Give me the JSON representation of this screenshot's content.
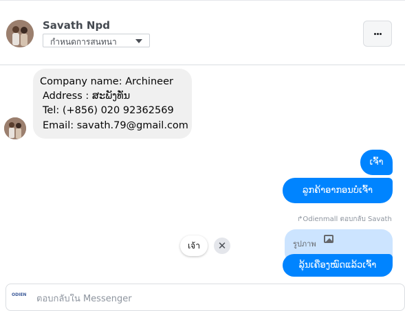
{
  "header": {
    "contact_name": "Savath Npd",
    "manage_label": "กำหนดการสนทนา",
    "more_icon": "more-horizontal-icon"
  },
  "messages": {
    "incoming": {
      "lines": [
        "Company name: Archineer",
        "Address : ສະພັງທັ່ນ",
        "Tel: (+856) 020 92362569",
        "Email: savath.79@gmail.com"
      ]
    },
    "outgoing_1": "ເຈົ້າ",
    "outgoing_2": "ລູກຄ້າອາກອນບໍ່ເຈົ້າ",
    "reply_meta": "Odienmall ตอบกลับ Savath",
    "quoted_text": "รูปภาพ",
    "outgoing_3": "ລຸ້ນເຄື່ອງໝົດແລ້ວເຈົ້າ"
  },
  "quick_reply": {
    "label": "เจ้า",
    "close_symbol": "✕"
  },
  "composer": {
    "placeholder": "ตอบกลับใน Messenger",
    "page_logo_text": "ODIEN"
  },
  "colors": {
    "accent": "#0084ff",
    "incoming_bubble": "#f0f0f0",
    "quoted_bubble": "#cce4ff"
  }
}
